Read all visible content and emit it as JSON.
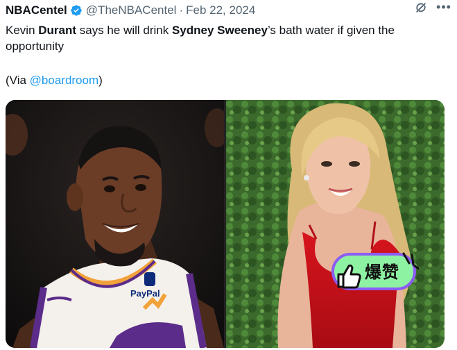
{
  "tweet": {
    "author_name": "NBACentel",
    "handle": "@TheNBACentel",
    "separator": "·",
    "date": "Feb 22, 2024",
    "text_part1": "Kevin ",
    "text_bold1": "Durant",
    "text_part2": " says he will drink ",
    "text_bold2": "Sydney Sweeney",
    "text_part3": "’s bath water if given the opportunity",
    "via_open": "(Via ",
    "via_mention": "@boardroom",
    "via_close": ")"
  },
  "icons": {
    "verified": "verified-badge-icon",
    "grok": "grok-icon",
    "more": "more-icon"
  },
  "media": {
    "left_photo": {
      "jersey_brand": "PayPal"
    },
    "right_photo": {}
  },
  "sticker": {
    "label": "爆赞"
  },
  "colors": {
    "link": "#1d9bf0",
    "secondary_text": "#536471",
    "verified": "#1d9bf0",
    "sticker_green": "#8ef2a3",
    "sticker_purple": "#8b5cf6"
  }
}
